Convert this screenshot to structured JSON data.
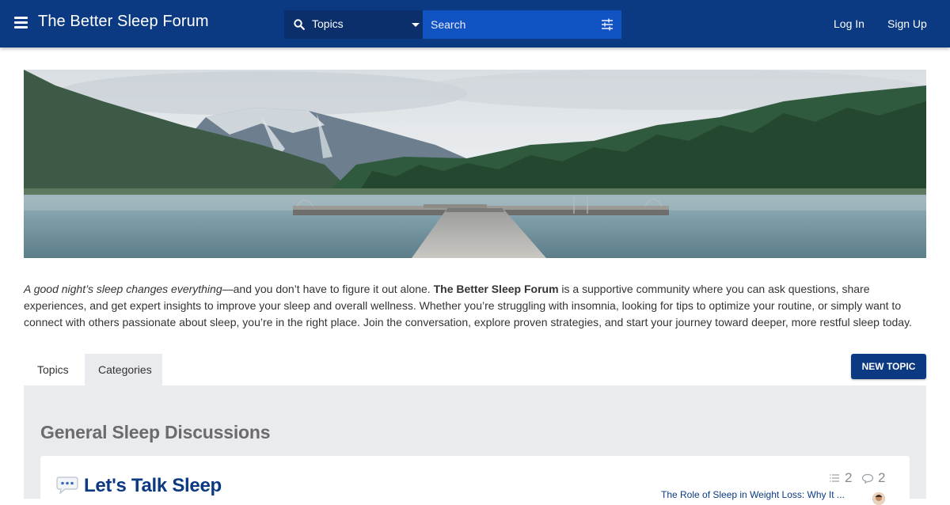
{
  "header": {
    "title": "The Better Sleep Forum",
    "search_scope": "Topics",
    "search_placeholder": "Search",
    "login": "Log In",
    "signup": "Sign Up"
  },
  "intro": {
    "italic": "A good night’s sleep changes everything",
    "lead": "—and you don’t have to figure it out alone. ",
    "bold": "The Better Sleep Forum",
    "body": " is a supportive community where you can ask questions, share experiences, and get expert insights to improve your sleep and overall wellness. Whether you’re struggling with insomnia, looking for tips to optimize your routine, or simply want to connect with others passionate about sleep, you’re in the right place. Join the conversation, explore proven strategies, and start your journey toward deeper, more restful sleep today."
  },
  "tabs": [
    {
      "label": "Topics"
    },
    {
      "label": "Categories"
    }
  ],
  "new_topic": "NEW TOPIC",
  "group": {
    "title": "General Sleep Discussions",
    "category": {
      "emoji": "💬",
      "title": "Let's Talk Sleep",
      "topics_count": "2",
      "posts_count": "2",
      "latest_topic": "The Role of Sleep in Weight Loss: Why It ..."
    }
  },
  "colors": {
    "brand": "#0b3a82",
    "search_bg": "#1253c4",
    "panel_bg": "#e9ebee"
  }
}
